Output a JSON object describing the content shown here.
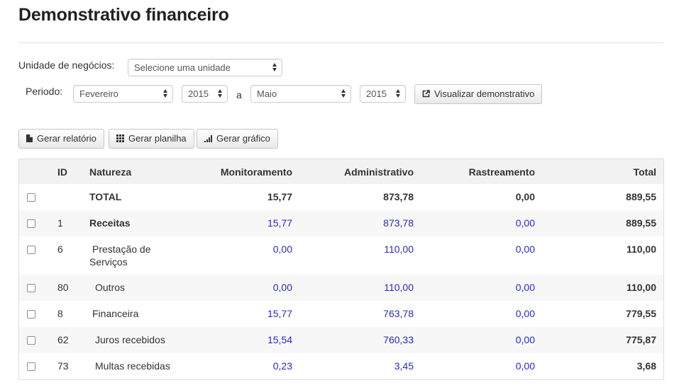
{
  "page": {
    "title": "Demonstrativo financeiro"
  },
  "filters": {
    "unit_label": "Unidade de negócios:",
    "unit_value": "Selecione uma unidade",
    "period_label": "Periodo:",
    "from_month": "Fevereiro",
    "from_year": "2015",
    "separator": "a",
    "to_month": "Maio",
    "to_year": "2015",
    "view_button": "Visualizar demonstrativo"
  },
  "toolbar": {
    "report_button": "Gerar relatório",
    "spreadsheet_button": "Gerar planilha",
    "chart_button": "Gerar gráfico"
  },
  "table": {
    "headers": {
      "id": "ID",
      "nature": "Natureza",
      "monitoring": "Monitoramento",
      "administrative": "Administrativo",
      "tracking": "Rastreamento",
      "total": "Total"
    },
    "rows": [
      {
        "id": "",
        "nature": "TOTAL",
        "nature2": "",
        "monitoring": "15,77",
        "administrative": "873,78",
        "tracking": "0,00",
        "total": "889,55"
      },
      {
        "id": "1",
        "nature": "Receitas",
        "nature2": "",
        "monitoring": "15,77",
        "administrative": "873,78",
        "tracking": "0,00",
        "total": "889,55"
      },
      {
        "id": "6",
        "nature": "Prestação de",
        "nature2": "Serviços",
        "monitoring": "0,00",
        "administrative": "110,00",
        "tracking": "0,00",
        "total": "110,00"
      },
      {
        "id": "80",
        "nature": "Outros",
        "nature2": "",
        "monitoring": "0,00",
        "administrative": "110,00",
        "tracking": "0,00",
        "total": "110,00"
      },
      {
        "id": "8",
        "nature": "Financeira",
        "nature2": "",
        "monitoring": "15,77",
        "administrative": "763,78",
        "tracking": "0,00",
        "total": "779,55"
      },
      {
        "id": "62",
        "nature": "Juros recebidos",
        "nature2": "",
        "monitoring": "15,54",
        "administrative": "760,33",
        "tracking": "0,00",
        "total": "775,87"
      },
      {
        "id": "73",
        "nature": "Multas recebidas",
        "nature2": "",
        "monitoring": "0,23",
        "administrative": "3,45",
        "tracking": "0,00",
        "total": "3,68"
      }
    ]
  },
  "colors": {
    "link_blue": "#2b2bb8",
    "stripe": "#f7f7f7",
    "header_bg": "#f2f2f2"
  }
}
